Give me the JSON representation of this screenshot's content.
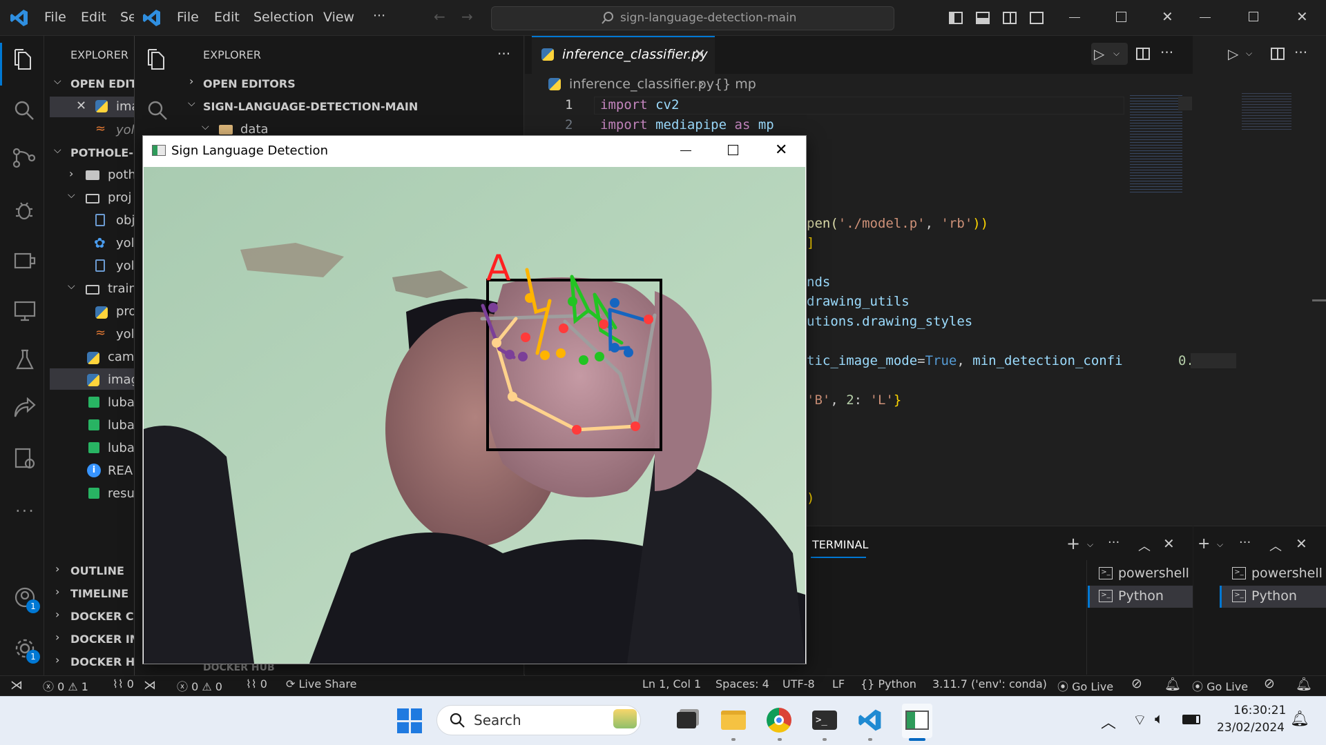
{
  "back_window": {
    "menu": [
      "File",
      "Edit",
      "Se"
    ],
    "explorer_label": "EXPLORER",
    "sections": [
      "OPEN EDITO",
      "POTHOLE-D"
    ],
    "open_editor_item": "ima",
    "open_editor_item2": "yol",
    "tree": [
      "poth",
      "proj",
      "obj",
      "yol",
      "yol",
      "train",
      "pro",
      "yol",
      "cam",
      "imag",
      "luba",
      "luba",
      "luba",
      "REAI",
      "resu"
    ],
    "bottom_sections": [
      "OUTLINE",
      "TIMELINE",
      "DOCKER CO",
      "DOCKER IM",
      "DOCKER HU"
    ],
    "badges": [
      "1",
      "1"
    ]
  },
  "front_window": {
    "menu": [
      "File",
      "Edit",
      "Selection",
      "View",
      "···"
    ],
    "search": "sign-language-detection-main",
    "explorer_label": "EXPLORER",
    "more": "···",
    "open_editors": "OPEN EDITORS",
    "project": "SIGN-LANGUAGE-DETECTION-MAIN",
    "folder_data": "data",
    "hidden_section": "DOCKER HUB",
    "tab_label": "inference_classifier.py",
    "breadcrumb_file": "inference_classifier.py",
    "breadcrumb_symbol": "{} mp",
    "line_numbers": [
      "1",
      "2"
    ],
    "code": {
      "l1_kw": "import",
      "l1_mod": "cv2",
      "l2_kw": "import",
      "l2_mod": "mediapipe",
      "l2_as": "as",
      "l2_alias": "mp",
      "frag1_fn": "pen(",
      "frag1_s1": "'./model.p'",
      "frag1_c": ", ",
      "frag1_s2": "'rb'",
      "frag1_end": "))",
      "frag2": "]",
      "frag3": "nds",
      "frag4": "drawing_utils",
      "frag5": "utions.drawing_styles",
      "frag6_var": "tic_image_mode",
      "frag6_eq": "=",
      "frag6_val": "True",
      "frag6_c": ", ",
      "frag6_var2": "min_detection_confi",
      "frag6_tail": "0.",
      "frag7_s": "'B'",
      "frag7_c": ", ",
      "frag7_n": "2",
      "frag7_col": ": ",
      "frag7_s2": "'L'",
      "frag7_end": "}",
      "frag8": ")"
    },
    "panel_tab": "TERMINAL",
    "terminals": [
      "powershell",
      "Python"
    ]
  },
  "detection_window": {
    "title": "Sign Language Detection",
    "predicted_letter": "A",
    "label_color": "#ff2020"
  },
  "status_bar": {
    "errors": "0",
    "warnings": "0",
    "ports": "0",
    "back_errors": "0",
    "back_warnings": "1",
    "live_share": "Live Share",
    "position": "Ln 1, Col 1",
    "spaces": "Spaces: 4",
    "encoding": "UTF-8",
    "eol": "LF",
    "language": "Python",
    "interpreter": "3.11.7 ('env': conda)",
    "go_live": "Go Live",
    "go_live2": "Go Live"
  },
  "taskbar": {
    "search_placeholder": "Search",
    "time": "16:30:21",
    "date": "23/02/2024"
  }
}
